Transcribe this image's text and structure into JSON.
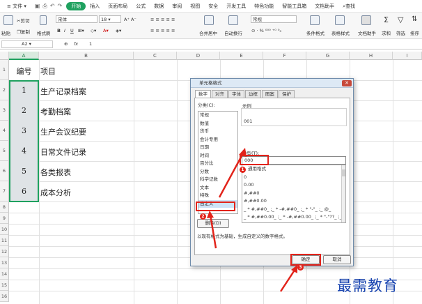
{
  "menubar": {
    "file_label": "文件",
    "tabs": [
      "开始",
      "插入",
      "页面布局",
      "公式",
      "数据",
      "审阅",
      "视图",
      "安全",
      "开发工具",
      "特色功能",
      "智能工具箱",
      "文档助手"
    ],
    "active_tab": "开始",
    "search_label": "查找"
  },
  "ribbon": {
    "paste_label": "粘贴",
    "cut_label": "剪切",
    "copy_label": "复制",
    "format_painter_label": "格式刷",
    "font_name": "宋体",
    "font_size": "18",
    "number_format": "常规",
    "merge_label": "合并居中",
    "wrap_label": "自动换行",
    "cond_format_label": "条件格式",
    "table_style_label": "表格样式",
    "doc_helper_label": "文档助手",
    "sum_label": "求和",
    "filter_label": "筛选",
    "sort_label": "排序"
  },
  "formulabar": {
    "cell_ref": "A2",
    "fx": "fx",
    "value": "1"
  },
  "grid": {
    "columns": [
      "A",
      "B",
      "C",
      "D",
      "E",
      "F",
      "G",
      "H",
      "I"
    ],
    "rows": [
      "1",
      "2",
      "3",
      "4",
      "5",
      "6",
      "7",
      "8",
      "9",
      "10",
      "11",
      "12",
      "13",
      "14",
      "15",
      "16"
    ],
    "header_a": "编号",
    "header_b": "项目",
    "data": [
      {
        "num": "1",
        "item": "生产记录档案"
      },
      {
        "num": "2",
        "item": "考勤档案"
      },
      {
        "num": "3",
        "item": "生产会议纪要"
      },
      {
        "num": "4",
        "item": "日常文件记录"
      },
      {
        "num": "5",
        "item": "各类报表"
      },
      {
        "num": "6",
        "item": "成本分析"
      }
    ]
  },
  "dialog": {
    "title": "单元格格式",
    "tabs": [
      "数字",
      "对齐",
      "字体",
      "边框",
      "图案",
      "保护"
    ],
    "category_label": "分类(C):",
    "categories": [
      "常规",
      "数值",
      "货币",
      "会计专用",
      "日期",
      "时间",
      "百分比",
      "分数",
      "科学记数",
      "文本",
      "特殊",
      "自定义"
    ],
    "selected_category": "自定义",
    "sample_label": "示例",
    "sample_value": "001",
    "type_label": "类型(T):",
    "type_value": "000",
    "formats": [
      "通用格式",
      "0",
      "0.00",
      "#,##0",
      "#,##0.00",
      "_ * #,##0_ ;_ * -#,##0_ ;_ * \"-\"_ ;_ @_",
      "_ * #,##0.00_ ;_ * -#,##0.00_ ;_ * \"-\"??_ ;_ @_"
    ],
    "delete_label": "删除(D)",
    "description": "以现有格式为基础，生成自定义的数字格式。",
    "ok_label": "确定",
    "cancel_label": "取消",
    "badges": [
      "1",
      "2",
      "3"
    ]
  },
  "watermark": "最需教育",
  "colors": {
    "accent": "#1fa15f",
    "annotation": "#e2231a",
    "watermark": "#1844b0"
  }
}
